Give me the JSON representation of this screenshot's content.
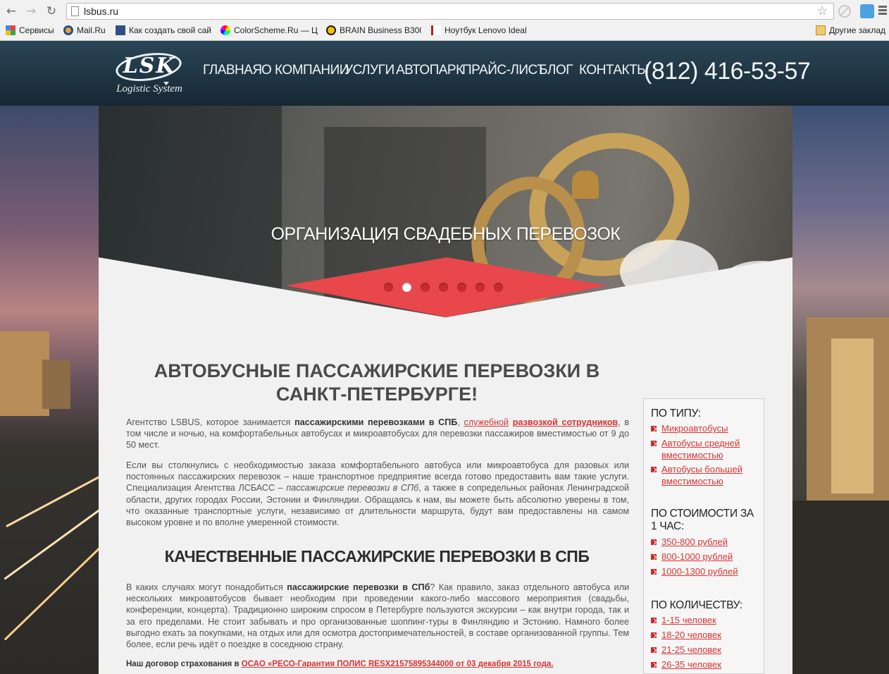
{
  "browser": {
    "url": "lsbus.ru",
    "bookmarks": [
      {
        "label": "Сервисы",
        "icon": "apps-icon"
      },
      {
        "label": "Mail.Ru",
        "icon": "mailru-icon"
      },
      {
        "label": "Как создать свой сай",
        "icon": "site-icon"
      },
      {
        "label": "ColorScheme.Ru — Ц",
        "icon": "colorscheme-icon"
      },
      {
        "label": "BRAIN Business B300",
        "icon": "brain-icon"
      },
      {
        "label": "Ноутбук Lenovo Ideal",
        "icon": "notebook-icon"
      }
    ],
    "other_bookmarks": "Другие заклад"
  },
  "header": {
    "logo_text": "LSK",
    "logo_subtitle": "Logistic System",
    "nav": [
      "ГЛАВНАЯ",
      "О КОМПАНИИ",
      "УСЛУГИ",
      "АВТОПАРК",
      "ПРАЙС-ЛИСТ",
      "БЛОГ",
      "КОНТАКТЫ"
    ],
    "phone": "(812) 416-53-57"
  },
  "slider": {
    "title": "ОРГАНИЗАЦИЯ СВАДЕБНЫХ ПЕРЕВОЗОК",
    "dot_count": 7,
    "active_dot": 2
  },
  "main": {
    "heading": "АВТОБУСНЫЕ ПАССАЖИРСКИЕ ПЕРЕВОЗКИ В САНКТ-ПЕТЕРБУРГЕ!",
    "p1": {
      "a": "Агентство LSBUS, которое занимается ",
      "b": "пассажирскими перевозками в СПБ",
      "c": ", ",
      "link1": "служебной",
      "d": " ",
      "link2": "развозкой сотрудников",
      "e": ", в том числе и ночью, на комфортабельных автобусах и микроавтобусах для перевозки пассажиров вместимостью от 9 до 50 мест."
    },
    "p2": {
      "a": "Если вы столкнулись с необходимостью заказа комфортабельного автобуса или микроавтобуса для разовых или постоянных пассажирских перевозок – наше транспортное предприятие всегда готово предоставить вам такие услуги. Специализация Агентства ЛСБАСС – ",
      "em": "пассажирские перевозки в СПб",
      "b": ", а также в сопредельных районах Ленинградской области, других городах России, Эстонии и Финляндии. Обращаясь к нам, вы можете быть абсолютно уверены в том, что оказанные транспортные услуги, независимо от длительности маршрута, будут вам предоставлены на самом высоком уровне и по вполне умеренной стоимости."
    },
    "heading2": "КАЧЕСТВЕННЫЕ ПАССАЖИРСКИЕ ПЕРЕВОЗКИ В СПБ",
    "p3": {
      "a": "В каких случаях могут понадобиться ",
      "b": "пассажирские перевозки в СПб",
      "c": "? Как правило, заказ отдельного автобуса или нескольких микроавтобусов бывает необходим при проведении какого-либо массового мероприятия (свадьбы, конференции, концерта). Традиционно широким спросом в Петербурге пользуются экскурсии – как внутри города, так и за его пределами. Не стоит забывать и про организованные шоппинг-туры в Финляндию и Эстонию. Намного более выгодно ехать за покупками, на отдых или для осмотра достопримечательностей, в составе организованной группы. Тем более, если речь идёт о поездке в соседнюю страну."
    },
    "contract_label": "Наш договор страхования в ",
    "contract_link": "ОСАО «РЕСО-Гарантия ПОЛИС RESX21575895344000 от 03 декабря 2015 года."
  },
  "sidebar": {
    "by_type": {
      "title": "ПО ТИПУ:",
      "items": [
        "Микроавтобусы",
        "Автобусы средней вместимостью",
        "Автобусы большей вместимостью"
      ]
    },
    "by_price": {
      "title": "ПО СТОИМОСТИ ЗА 1 ЧАС:",
      "items": [
        "350-800 рублей",
        "800-1000 рублей",
        "1000-1300 рублей"
      ]
    },
    "by_count": {
      "title": "ПО КОЛИЧЕСТВУ:",
      "items": [
        "1-15 человек",
        "18-20 человек",
        "21-25 человек",
        "26-35 человек"
      ]
    }
  },
  "colors": {
    "accent": "#e8474b",
    "header_bg": "#1f3441",
    "content_bg": "#f1f1f1",
    "link": "#d33333"
  }
}
